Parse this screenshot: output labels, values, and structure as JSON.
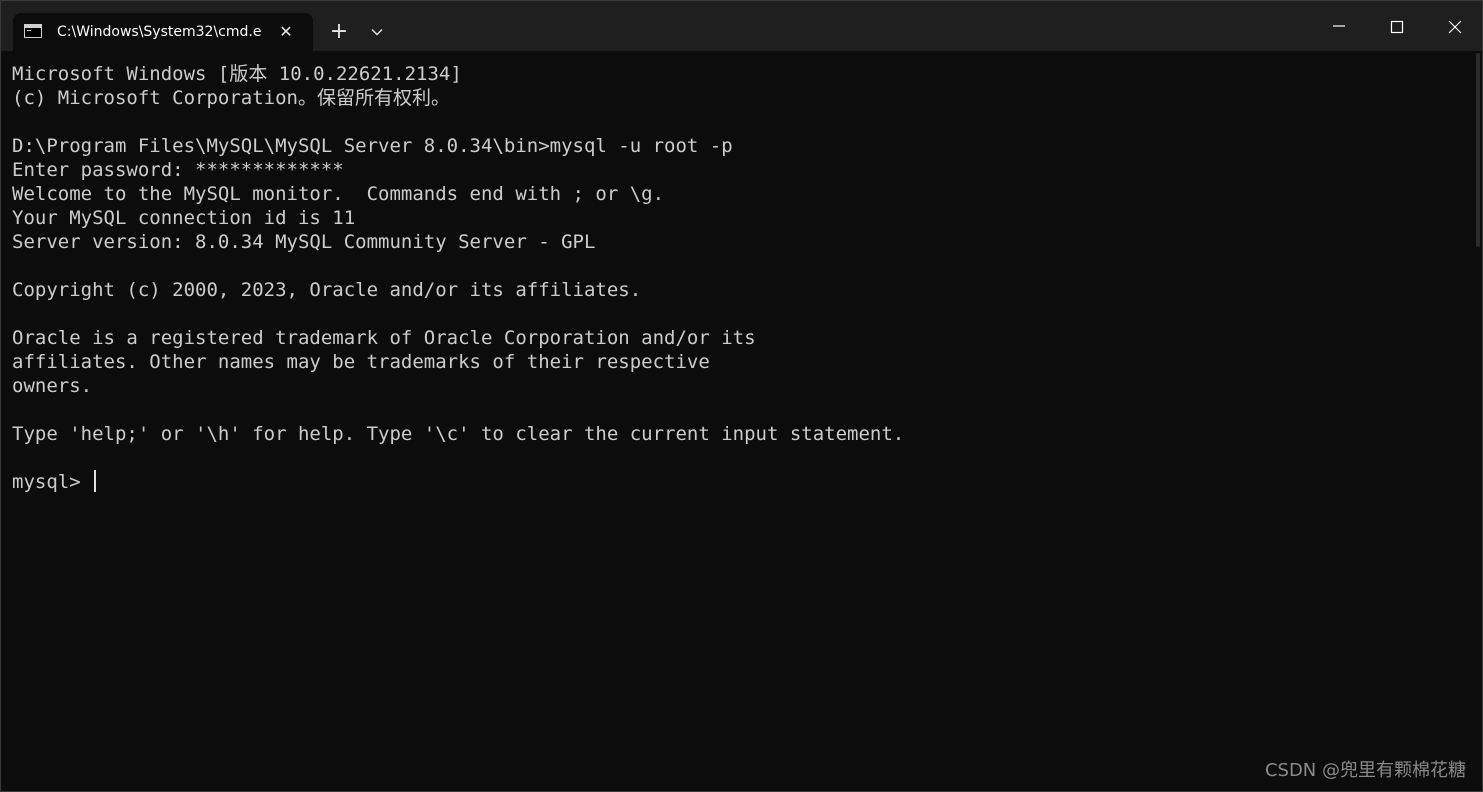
{
  "window": {
    "tab_title": "C:\\Windows\\System32\\cmd.e",
    "tab_icon": "cmd-icon",
    "new_tab_label": "+",
    "close_tab_glyph": "✕"
  },
  "console": {
    "lines": [
      "Microsoft Windows [版本 10.0.22621.2134]",
      "(c) Microsoft Corporation。保留所有权利。",
      "",
      "D:\\Program Files\\MySQL\\MySQL Server 8.0.34\\bin>mysql -u root -p",
      "Enter password: *************",
      "Welcome to the MySQL monitor.  Commands end with ; or \\g.",
      "Your MySQL connection id is 11",
      "Server version: 8.0.34 MySQL Community Server - GPL",
      "",
      "Copyright (c) 2000, 2023, Oracle and/or its affiliates.",
      "",
      "Oracle is a registered trademark of Oracle Corporation and/or its",
      "affiliates. Other names may be trademarks of their respective",
      "owners.",
      "",
      "Type 'help;' or '\\h' for help. Type '\\c' to clear the current input statement.",
      ""
    ],
    "prompt": "mysql> "
  },
  "watermark": "CSDN @兜里有颗棉花糖",
  "colors": {
    "background": "#0c0c0c",
    "titlebar": "#1f1f1f",
    "text": "#cccccc"
  }
}
